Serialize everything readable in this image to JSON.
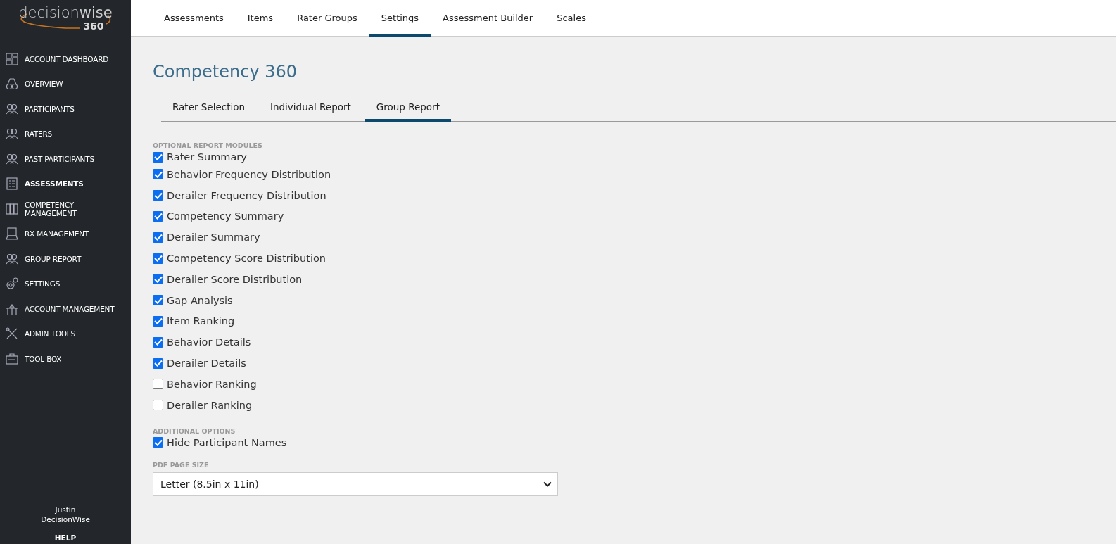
{
  "logo": {
    "name": "decision**wise**",
    "number": "360"
  },
  "sidebar": {
    "items": [
      {
        "label": "ACCOUNT DASHBOARD",
        "selected": false
      },
      {
        "label": "OVERVIEW",
        "selected": false
      },
      {
        "label": "PARTICIPANTS",
        "selected": false
      },
      {
        "label": "RATERS",
        "selected": false
      },
      {
        "label": "PAST PARTICIPANTS",
        "selected": false
      },
      {
        "label": "ASSESSMENTS",
        "selected": true
      },
      {
        "label": "COMPETENCY MANAGEMENT",
        "selected": false
      },
      {
        "label": "RX MANAGEMENT",
        "selected": false
      },
      {
        "label": "GROUP REPORT",
        "selected": false
      },
      {
        "label": "SETTINGS",
        "selected": false
      },
      {
        "label": "ACCOUNT MANAGEMENT",
        "selected": false
      },
      {
        "label": "ADMIN TOOLS",
        "selected": false
      },
      {
        "label": "TOOL BOX",
        "selected": false
      }
    ],
    "user": [
      "Justin",
      "DecisionWise"
    ],
    "help": "HELP"
  },
  "top_tabs": [
    {
      "label": "Assessments",
      "selected": false
    },
    {
      "label": "Items",
      "selected": false
    },
    {
      "label": "Rater Groups",
      "selected": false
    },
    {
      "label": "Settings",
      "selected": true
    },
    {
      "label": "Assessment Builder",
      "selected": false
    },
    {
      "label": "Scales",
      "selected": false
    }
  ],
  "page_title": "Competency 360",
  "sub_tabs": [
    {
      "label": "Rater Selection",
      "selected": false
    },
    {
      "label": "Individual Report",
      "selected": false
    },
    {
      "label": "Group Report",
      "selected": true
    }
  ],
  "modules": {
    "heading": "OPTIONAL REPORT MODULES",
    "options": [
      {
        "label": "Rater Summary",
        "checked": true
      },
      {
        "label": "Behavior Frequency Distribution",
        "checked": true
      },
      {
        "label": "Derailer Frequency Distribution",
        "checked": true
      },
      {
        "label": "Competency Summary",
        "checked": true
      },
      {
        "label": "Derailer Summary",
        "checked": true
      },
      {
        "label": "Competency Score Distribution",
        "checked": true
      },
      {
        "label": "Derailer Score Distribution",
        "checked": true
      },
      {
        "label": "Gap Analysis",
        "checked": true
      },
      {
        "label": "Item Ranking",
        "checked": true
      },
      {
        "label": "Behavior Details",
        "checked": true
      },
      {
        "label": "Derailer Details",
        "checked": true
      },
      {
        "label": "Behavior Ranking",
        "checked": false
      },
      {
        "label": "Derailer Ranking",
        "checked": false
      }
    ]
  },
  "additional": {
    "heading": "ADDITIONAL OPTIONS",
    "options": [
      {
        "label": "Hide Participant Names",
        "checked": true
      }
    ]
  },
  "page_size": {
    "label": "PDF PAGE SIZE",
    "value": "Letter (8.5in x 11in)"
  }
}
